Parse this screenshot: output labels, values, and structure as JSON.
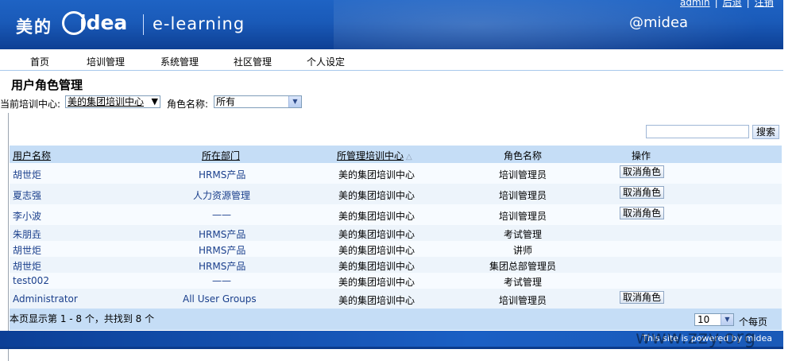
{
  "header": {
    "logo_cn": "美的",
    "logo_en": "idea",
    "product": "e-learning",
    "tagline": "@midea",
    "links": [
      "admin",
      "后退",
      "注销"
    ]
  },
  "nav": [
    "首页",
    "培训管理",
    "系统管理",
    "社区管理",
    "个人设定"
  ],
  "page_title": "用户角色管理",
  "filters": {
    "center_label": "当前培训中心:",
    "center_value": "美的集团培训中心",
    "role_label": "角色名称:",
    "role_value": "所有"
  },
  "search": {
    "value": "",
    "button": "搜索"
  },
  "table": {
    "headers": [
      "用户名称",
      "所在部门",
      "所管理培训中心",
      "角色名称",
      "操作"
    ],
    "sort_indicator": "△",
    "rows": [
      {
        "name": "胡世炬",
        "dept": "HRMS产品",
        "center": "美的集团培训中心",
        "role": "培训管理员",
        "action": "取消角色"
      },
      {
        "name": "夏志强",
        "dept": "人力资源管理",
        "center": "美的集团培训中心",
        "role": "培训管理员",
        "action": "取消角色"
      },
      {
        "name": "李小波",
        "dept": "——",
        "center": "美的集团培训中心",
        "role": "培训管理员",
        "action": "取消角色"
      },
      {
        "name": "朱朋垚",
        "dept": "HRMS产品",
        "center": "美的集团培训中心",
        "role": "考试管理",
        "action": ""
      },
      {
        "name": "胡世炬",
        "dept": "HRMS产品",
        "center": "美的集团培训中心",
        "role": "讲师",
        "action": ""
      },
      {
        "name": "胡世炬",
        "dept": "HRMS产品",
        "center": "美的集团培训中心",
        "role": "集团总部管理员",
        "action": ""
      },
      {
        "name": "test002",
        "dept": "——",
        "center": "美的集团培训中心",
        "role": "考试管理",
        "action": ""
      },
      {
        "name": "Administrator",
        "dept": "All User Groups",
        "center": "美的集团培训中心",
        "role": "培训管理员",
        "action": "取消角色"
      }
    ]
  },
  "footer_bar": {
    "info": "本页显示第 1 - 8 个，共找到 8 个",
    "page_size": "10",
    "per_page_label": "个每页"
  },
  "footer": {
    "powered": "This site is powered by midea"
  },
  "watermark": "www.zzy.org"
}
